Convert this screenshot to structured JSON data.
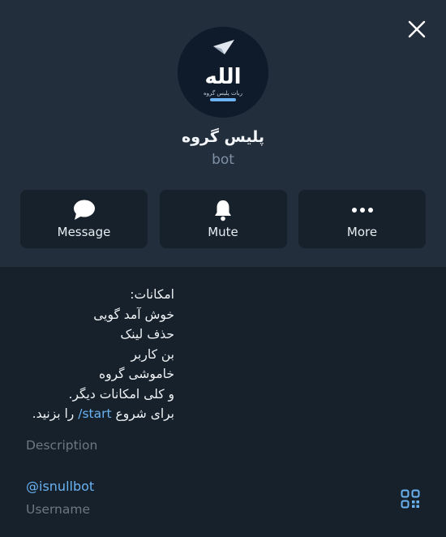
{
  "profile": {
    "name": "پلیس گروه",
    "type": "bot",
    "avatar_text": "الله",
    "avatar_caption": "ربات پلیس گروه"
  },
  "actions": [
    {
      "label": "Message",
      "icon": "chat-bubble-icon"
    },
    {
      "label": "Mute",
      "icon": "bell-icon"
    },
    {
      "label": "More",
      "icon": "more-dots-icon"
    }
  ],
  "description": {
    "lines": [
      "امکانات:",
      "خوش آمد گویی",
      "حذف لینک",
      "بن کاربر",
      "خاموشی گروه",
      "و کلی امکانات دیگر."
    ],
    "last_line_before": "برای شروع ",
    "last_line_link": "/start",
    "last_line_after": " را بزنید.",
    "label": "Description"
  },
  "username": {
    "value": "@isnullbot",
    "label": "Username"
  },
  "colors": {
    "header_bg": "#232e3c",
    "body_bg": "#17212b",
    "link": "#6ab2f2",
    "muted": "#6c7883"
  }
}
